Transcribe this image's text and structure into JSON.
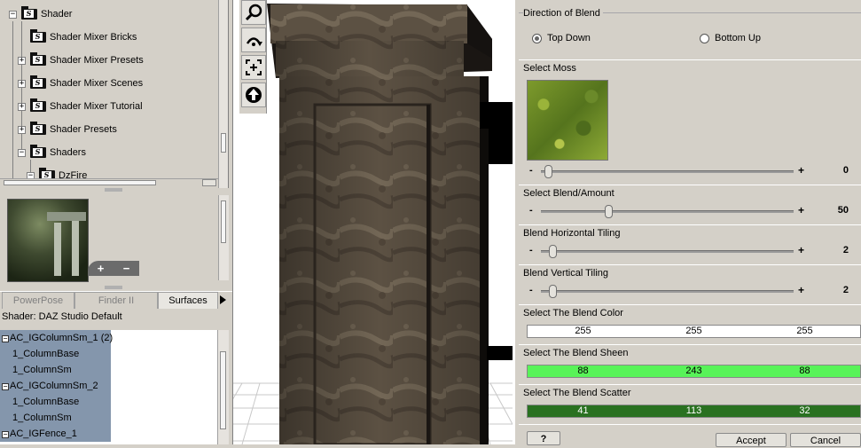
{
  "tree": {
    "items": [
      {
        "label": "Shader",
        "expander": "−"
      },
      {
        "label": "Shader Mixer Bricks",
        "expander": ""
      },
      {
        "label": "Shader Mixer Presets",
        "expander": "+"
      },
      {
        "label": "Shader Mixer Scenes",
        "expander": "+"
      },
      {
        "label": "Shader Mixer Tutorial",
        "expander": "+"
      },
      {
        "label": "Shader Presets",
        "expander": "+"
      },
      {
        "label": "Shaders",
        "expander": "−"
      },
      {
        "label": "DzFire",
        "expander": "−"
      }
    ],
    "folder_badge": "S"
  },
  "preview": {
    "add": "+",
    "remove": "−"
  },
  "tabs": [
    {
      "label": "PowerPose",
      "active": false
    },
    {
      "label": "Finder II",
      "active": false
    },
    {
      "label": "Surfaces",
      "active": true
    }
  ],
  "shader_line": "Shader: DAZ Studio Default",
  "surfaces": [
    "AC_IGColumnSm_1 (2)",
    "1_ColumnBase",
    "1_ColumnSm",
    "AC_IGColumnSm_2",
    "1_ColumnBase",
    "1_ColumnSm",
    "AC_IGFence_1"
  ],
  "toolbar": {
    "icons": [
      "zoom-icon",
      "orbit-icon",
      "frame-icon",
      "up-arrow-icon"
    ]
  },
  "blend_panel": {
    "direction_title": "Direction of Blend",
    "top_down": "Top Down",
    "bottom_up": "Bottom Up",
    "selected_direction": "top_down",
    "moss_title": "Select Moss",
    "moss_value": "0",
    "moss_fraction": 0.0,
    "amount_title": "Select Blend/Amount",
    "amount_value": "50",
    "amount_fraction": 0.25,
    "htile_title": "Blend Horizontal Tiling",
    "htile_value": "2",
    "htile_fraction": 0.02,
    "vtile_title": "Blend Vertical Tiling",
    "vtile_value": "2",
    "vtile_fraction": 0.02,
    "minus": "-",
    "plus": "+",
    "color_title": "Select The Blend Color",
    "color_values": [
      "255",
      "255",
      "255"
    ],
    "color_hex": "#ffffff",
    "sheen_title": "Select The Blend Sheen",
    "sheen_values": [
      "88",
      "243",
      "88"
    ],
    "sheen_hex": "#58f358",
    "scatter_title": "Select The Blend Scatter",
    "scatter_values": [
      "41",
      "113",
      "32"
    ],
    "scatter_hex": "#297120",
    "help_label": "?",
    "accept_label": "Accept",
    "cancel_label": "Cancel"
  }
}
